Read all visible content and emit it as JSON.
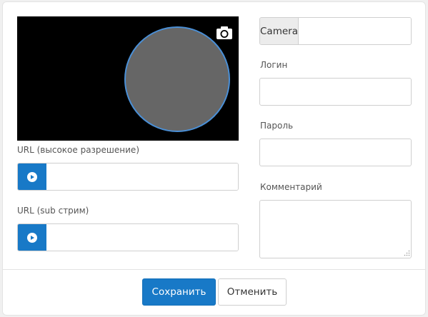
{
  "preview": {
    "snapshot_icon": "camera-icon"
  },
  "url_high": {
    "label": "URL (высокое разрешение)",
    "value": "",
    "play_icon": "play-icon"
  },
  "url_sub": {
    "label": "URL (sub стрим)",
    "value": "",
    "play_icon": "play-icon"
  },
  "camera": {
    "addon_label": "Camera",
    "value": ""
  },
  "login": {
    "label": "Логин",
    "value": ""
  },
  "password": {
    "label": "Пароль",
    "value": ""
  },
  "comment": {
    "label": "Комментарий",
    "value": ""
  },
  "footer": {
    "save_label": "Сохранить",
    "cancel_label": "Отменить"
  },
  "colors": {
    "accent": "#1879c7",
    "preview_bg": "#000000",
    "circle_fill": "#666666",
    "circle_border": "#4a8fd6"
  }
}
